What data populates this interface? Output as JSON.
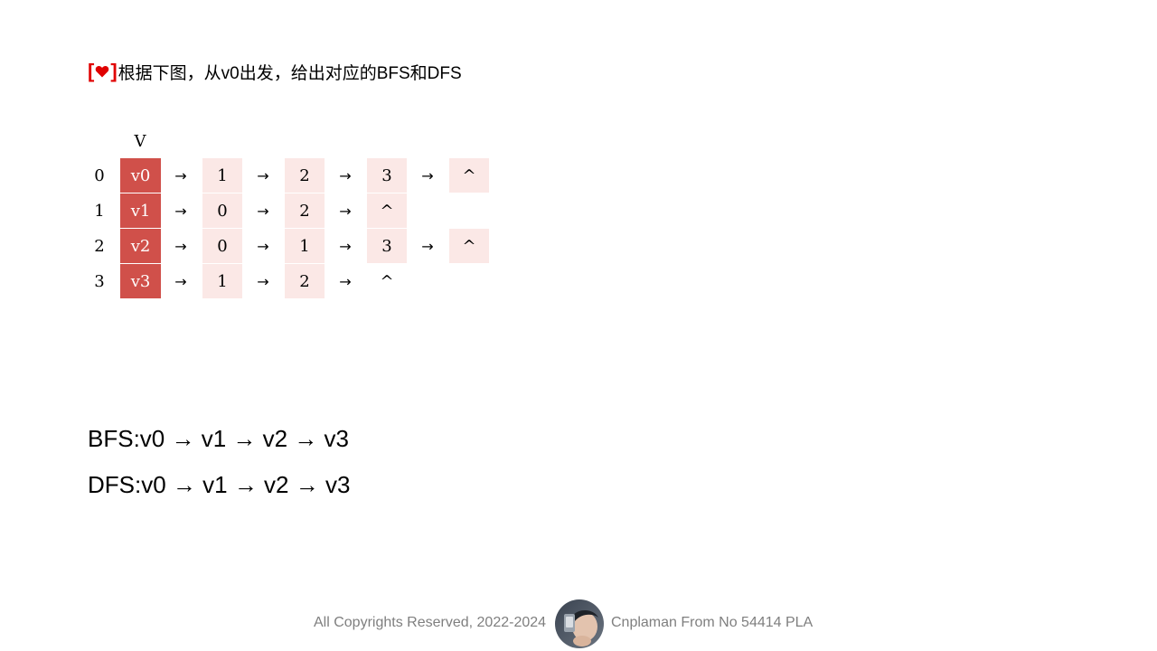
{
  "question": {
    "bracket_open": "[",
    "bracket_close": "]",
    "heart_icon": "heart-icon",
    "text": "根据下图，从v0出发，给出对应的BFS和DFS"
  },
  "adjacency_list": {
    "header": "V",
    "arrow": "→",
    "rows": [
      {
        "index": "0",
        "vertex": "v0",
        "neighbors": [
          "1",
          "2",
          "3"
        ],
        "end": "^"
      },
      {
        "index": "1",
        "vertex": "v1",
        "neighbors": [
          "0",
          "2"
        ],
        "end": "^"
      },
      {
        "index": "2",
        "vertex": "v2",
        "neighbors": [
          "0",
          "1",
          "3"
        ],
        "end": "^"
      },
      {
        "index": "3",
        "vertex": "v3",
        "neighbors": [
          "1",
          "2"
        ],
        "end": "^"
      }
    ]
  },
  "answers": {
    "bfs": "BFS:v0 → v1 → v2 → v3",
    "dfs": "DFS:v0 → v1 → v2 → v3"
  },
  "footer": {
    "copyright": "All Copyrights Reserved, 2022-2024",
    "author": "Cnplaman From No 54414 PLA"
  },
  "colors": {
    "accent_red": "#e00000",
    "vertex_fill": "#d0504a",
    "node_fill": "#fbe8e6",
    "footer_text": "#7f7f7f"
  }
}
